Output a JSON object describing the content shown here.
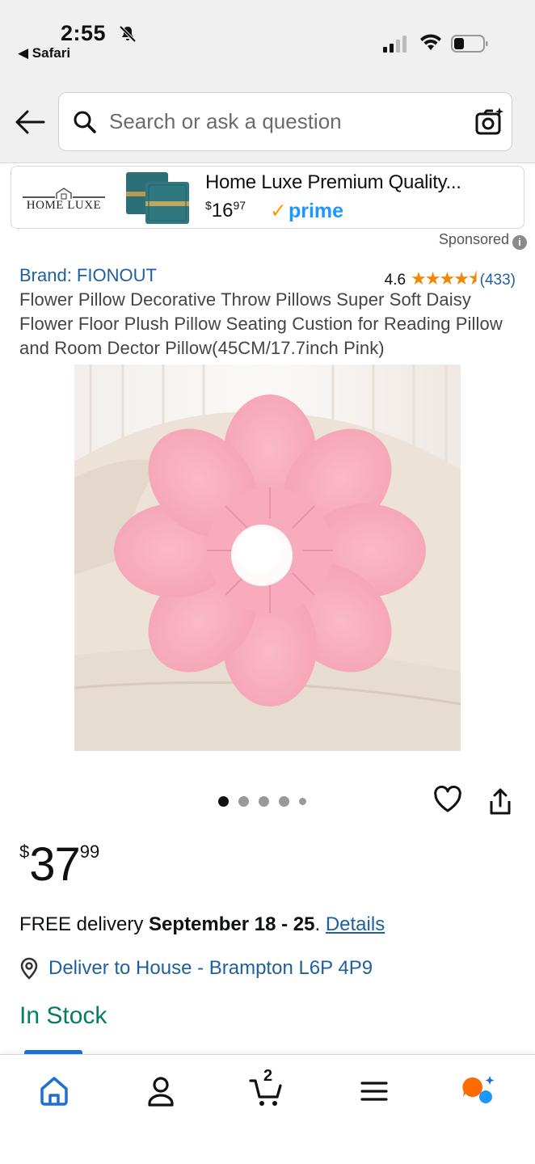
{
  "status_bar": {
    "time": "2:55",
    "back_app": "Safari"
  },
  "search": {
    "placeholder": "Search or ask a question"
  },
  "sponsored_banner": {
    "logo_text": "HOME LUXE",
    "title": "Home Luxe Premium Quality...",
    "price_symbol": "$",
    "price_whole": "16",
    "price_fraction": "97",
    "prime_label": "prime",
    "sponsored_label": "Sponsored"
  },
  "product": {
    "brand": "Brand: FIONOUT",
    "rating_value": "4.6",
    "rating_stars": 4.6,
    "rating_count": "(433)",
    "title": "Flower Pillow Decorative Throw Pillows Super Soft Daisy Flower Floor Plush Pillow Seating Custion for Reading Pillow and Room Dector Pillow(45CM/17.7inch Pink)",
    "image_count": 5,
    "active_image": 1,
    "price_symbol": "$",
    "price_whole": "37",
    "price_fraction": "99",
    "delivery_prefix": "FREE delivery ",
    "delivery_dates": "September 18 - 25",
    "delivery_suffix": ". ",
    "details_link": "Details",
    "deliver_to": "Deliver to House - Brampton L6P 4P9",
    "stock": "In Stock"
  },
  "nav": {
    "cart_count": "2",
    "items": [
      "home-icon",
      "account-icon",
      "cart-icon",
      "menu-icon",
      "rufus-icon"
    ]
  },
  "colors": {
    "link": "#1f5f9e",
    "in_stock": "#067d62",
    "star": "#f08804",
    "prime": "#1a98ff",
    "nav_active": "#1f6fd0"
  }
}
